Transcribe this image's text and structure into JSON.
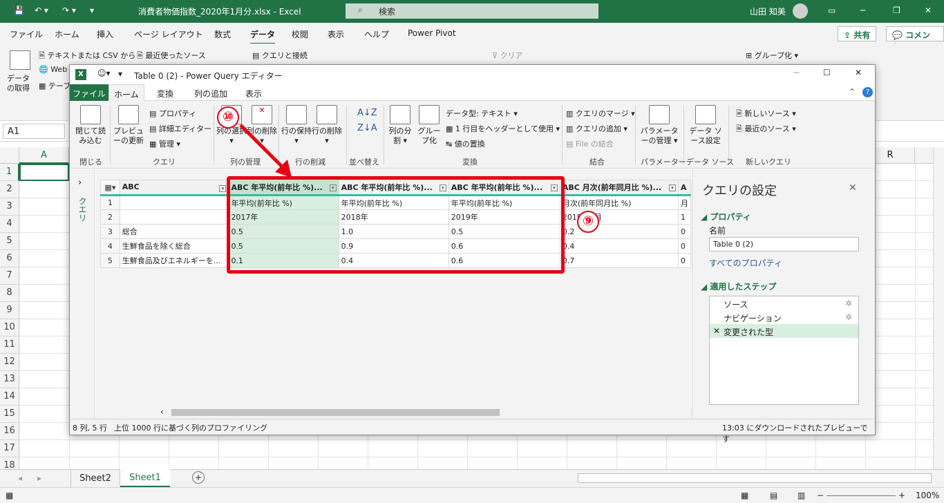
{
  "excel": {
    "title": "消費者物価指数_2020年1月分.xlsx  -  Excel",
    "search_placeholder": "検索",
    "user": "山田 知美",
    "menu": [
      "ファイル",
      "ホーム",
      "挿入",
      "ページ レイアウト",
      "数式",
      "データ",
      "校閲",
      "表示",
      "ヘルプ",
      "Power Pivot"
    ],
    "share_label": "共有",
    "comment_label": "コメント",
    "ribbon": {
      "get_data": "データの取得",
      "text_csv": "テキストまたは CSV から",
      "recent_sources": "最近使ったソース",
      "web": "Web",
      "table": "テーブ",
      "queries_connections": "クエリと接続",
      "clear": "クリア",
      "group": "グループ化"
    },
    "namebox": "A1",
    "columns": [
      "A",
      "R"
    ],
    "rows": [
      "1",
      "2",
      "3",
      "4",
      "5",
      "6",
      "7",
      "8",
      "9",
      "10",
      "11",
      "12",
      "13",
      "14",
      "15",
      "16",
      "17",
      "18"
    ],
    "sheets": [
      "Sheet2",
      "Sheet1"
    ],
    "zoom": "100%"
  },
  "pq": {
    "title": "Table 0 (2) - Power Query エディター",
    "tabs": {
      "file": "ファイル",
      "home": "ホーム",
      "transform": "変換",
      "add_column": "列の追加",
      "view": "表示"
    },
    "ribbon": {
      "close_load": "閉じて読み込む",
      "preview_refresh": "プレビューの更新",
      "properties": "プロパティ",
      "advanced_editor": "詳細エディター",
      "manage": "管理",
      "choose_columns": "列の選択",
      "remove_columns": "列の削除",
      "keep_rows": "行の保持",
      "remove_rows": "行の削除",
      "split_column": "列の分割",
      "group_by": "グループ化",
      "data_type": "データ型: テキスト",
      "use_first_row": "1 行目をヘッダーとして使用",
      "replace_values": "値の置換",
      "merge_queries": "クエリのマージ",
      "append_queries": "クエリの追加",
      "combine_files": "File の結合",
      "manage_parameters": "パラメーターの管理",
      "data_source_settings": "データ ソース設定",
      "new_source": "新しいソース",
      "recent_sources": "最近のソース",
      "groups": [
        "閉じる",
        "クエリ",
        "列の管理",
        "行の削減",
        "並べ替え",
        "変換",
        "結合",
        "パラメーター",
        "データ ソース",
        "新しいクエリ"
      ]
    },
    "queries_label": "クエリ",
    "table": {
      "headers": [
        "年平均(前年比 %)...",
        "年平均(前年比 %)...",
        "年平均(前年比 %)...",
        "月次(前年同月比 %)..."
      ],
      "rows": [
        [
          "1",
          "",
          "年平均(前年比 %)",
          "年平均(前年比 %)",
          "年平均(前年比 %)",
          "月次(前年同月比 %)",
          "月"
        ],
        [
          "2",
          "",
          "2017年",
          "2018年",
          "2019年",
          "2019年1月",
          "1"
        ],
        [
          "3",
          "総合",
          "0.5",
          "1.0",
          "0.5",
          "0.2",
          "0"
        ],
        [
          "4",
          "生鮮食品を除く総合",
          "0.5",
          "0.9",
          "0.6",
          "0.4",
          "0"
        ],
        [
          "5",
          "生鮮食品及びエネルギーを...",
          "0.1",
          "0.4",
          "0.6",
          "0.7",
          "0"
        ]
      ]
    },
    "settings": {
      "title": "クエリの設定",
      "properties_header": "プロパティ",
      "name_label": "名前",
      "name_value": "Table 0 (2)",
      "all_properties": "すべてのプロパティ",
      "steps_header": "適用したステップ",
      "steps": [
        "ソース",
        "ナビゲーション",
        "変更された型"
      ]
    },
    "status_left": "8 列, 5 行",
    "status_profile": "上位 1000 行に基づく列のプロファイリング",
    "status_right": "13:03 にダウンロードされたプレビューです"
  },
  "annotations": {
    "badge10": "⑩",
    "badge9": "⑨"
  },
  "colors": {
    "excel_green": "#217346",
    "annotation_red": "#e60012",
    "selection": "#d8eedf",
    "header_underline": "#3db8a8"
  }
}
